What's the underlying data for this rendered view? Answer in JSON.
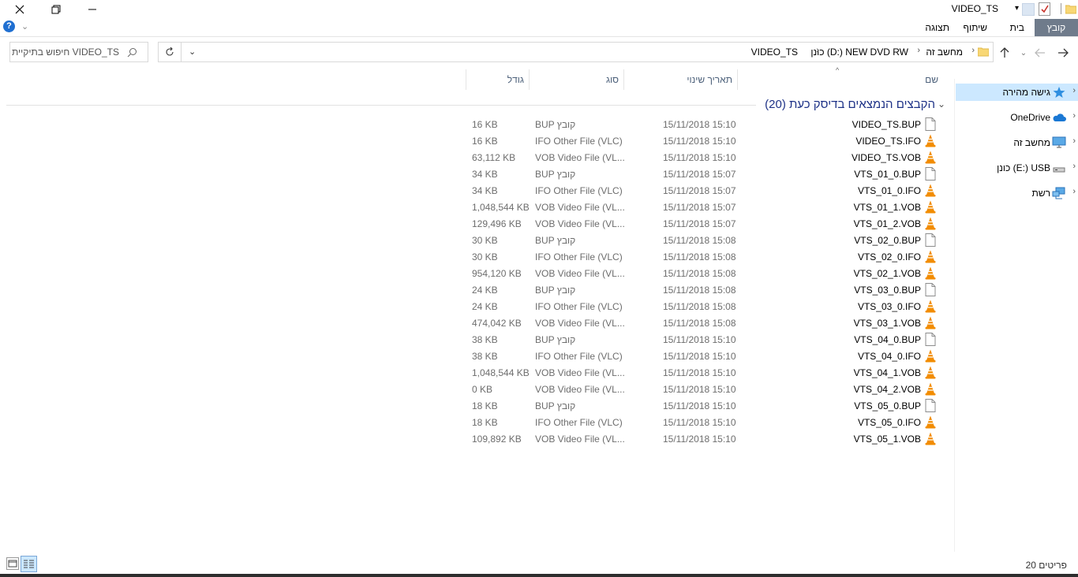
{
  "window": {
    "title": "VIDEO_TS"
  },
  "ribbon": {
    "tabs": [
      "קובץ",
      "בית",
      "שיתוף",
      "תצוגה"
    ]
  },
  "address": {
    "crumbs": [
      "מחשב זה",
      "כונן (D:) NEW DVD RW",
      "VIDEO_TS"
    ]
  },
  "search": {
    "placeholder": "חיפוש בתיקיית VIDEO_TS"
  },
  "columns": {
    "name": "שם",
    "date": "תאריך שינוי",
    "type": "סוג",
    "size": "גודל"
  },
  "group": {
    "label": "הקבצים הנמצאים בדיסק כעת (20)"
  },
  "files": [
    {
      "name": "VIDEO_TS.BUP",
      "date": "15/11/2018 15:10",
      "type": "BUP קובץ",
      "size": "16 KB",
      "icon": "generic-file-icon"
    },
    {
      "name": "VIDEO_TS.IFO",
      "date": "15/11/2018 15:10",
      "type": "IFO Other File (VLC)",
      "size": "16 KB",
      "icon": "vlc-icon"
    },
    {
      "name": "VIDEO_TS.VOB",
      "date": "15/11/2018 15:10",
      "type": "VOB Video File (VL...",
      "size": "63,112 KB",
      "icon": "vlc-icon"
    },
    {
      "name": "VTS_01_0.BUP",
      "date": "15/11/2018 15:07",
      "type": "BUP קובץ",
      "size": "34 KB",
      "icon": "generic-file-icon"
    },
    {
      "name": "VTS_01_0.IFO",
      "date": "15/11/2018 15:07",
      "type": "IFO Other File (VLC)",
      "size": "34 KB",
      "icon": "vlc-icon"
    },
    {
      "name": "VTS_01_1.VOB",
      "date": "15/11/2018 15:07",
      "type": "VOB Video File (VL...",
      "size": "1,048,544 KB",
      "icon": "vlc-icon"
    },
    {
      "name": "VTS_01_2.VOB",
      "date": "15/11/2018 15:07",
      "type": "VOB Video File (VL...",
      "size": "129,496 KB",
      "icon": "vlc-icon"
    },
    {
      "name": "VTS_02_0.BUP",
      "date": "15/11/2018 15:08",
      "type": "BUP קובץ",
      "size": "30 KB",
      "icon": "generic-file-icon"
    },
    {
      "name": "VTS_02_0.IFO",
      "date": "15/11/2018 15:08",
      "type": "IFO Other File (VLC)",
      "size": "30 KB",
      "icon": "vlc-icon"
    },
    {
      "name": "VTS_02_1.VOB",
      "date": "15/11/2018 15:08",
      "type": "VOB Video File (VL...",
      "size": "954,120 KB",
      "icon": "vlc-icon"
    },
    {
      "name": "VTS_03_0.BUP",
      "date": "15/11/2018 15:08",
      "type": "BUP קובץ",
      "size": "24 KB",
      "icon": "generic-file-icon"
    },
    {
      "name": "VTS_03_0.IFO",
      "date": "15/11/2018 15:08",
      "type": "IFO Other File (VLC)",
      "size": "24 KB",
      "icon": "vlc-icon"
    },
    {
      "name": "VTS_03_1.VOB",
      "date": "15/11/2018 15:08",
      "type": "VOB Video File (VL...",
      "size": "474,042 KB",
      "icon": "vlc-icon"
    },
    {
      "name": "VTS_04_0.BUP",
      "date": "15/11/2018 15:10",
      "type": "BUP קובץ",
      "size": "38 KB",
      "icon": "generic-file-icon"
    },
    {
      "name": "VTS_04_0.IFO",
      "date": "15/11/2018 15:10",
      "type": "IFO Other File (VLC)",
      "size": "38 KB",
      "icon": "vlc-icon"
    },
    {
      "name": "VTS_04_1.VOB",
      "date": "15/11/2018 15:10",
      "type": "VOB Video File (VL...",
      "size": "1,048,544 KB",
      "icon": "vlc-icon"
    },
    {
      "name": "VTS_04_2.VOB",
      "date": "15/11/2018 15:10",
      "type": "VOB Video File (VL...",
      "size": "0 KB",
      "icon": "vlc-icon"
    },
    {
      "name": "VTS_05_0.BUP",
      "date": "15/11/2018 15:10",
      "type": "BUP קובץ",
      "size": "18 KB",
      "icon": "generic-file-icon"
    },
    {
      "name": "VTS_05_0.IFO",
      "date": "15/11/2018 15:10",
      "type": "IFO Other File (VLC)",
      "size": "18 KB",
      "icon": "vlc-icon"
    },
    {
      "name": "VTS_05_1.VOB",
      "date": "15/11/2018 15:10",
      "type": "VOB Video File (VL...",
      "size": "109,892 KB",
      "icon": "vlc-icon"
    }
  ],
  "navpane": {
    "items": [
      {
        "label": "גישה מהירה",
        "icon": "quick-access-star-icon",
        "selected": true
      },
      {
        "label": "OneDrive",
        "icon": "onedrive-cloud-icon",
        "selected": false
      },
      {
        "label": "מחשב זה",
        "icon": "computer-icon",
        "selected": false
      },
      {
        "label": "כונן (E:) USB",
        "icon": "usb-drive-icon",
        "selected": false
      },
      {
        "label": "רשת",
        "icon": "network-icon",
        "selected": false
      }
    ]
  },
  "status": {
    "count": "20 פריטים"
  },
  "colors": {
    "accent": "#6f7b8b",
    "group": "#1e3287",
    "selection": "#cce8ff",
    "vlc": "#f28c00"
  }
}
